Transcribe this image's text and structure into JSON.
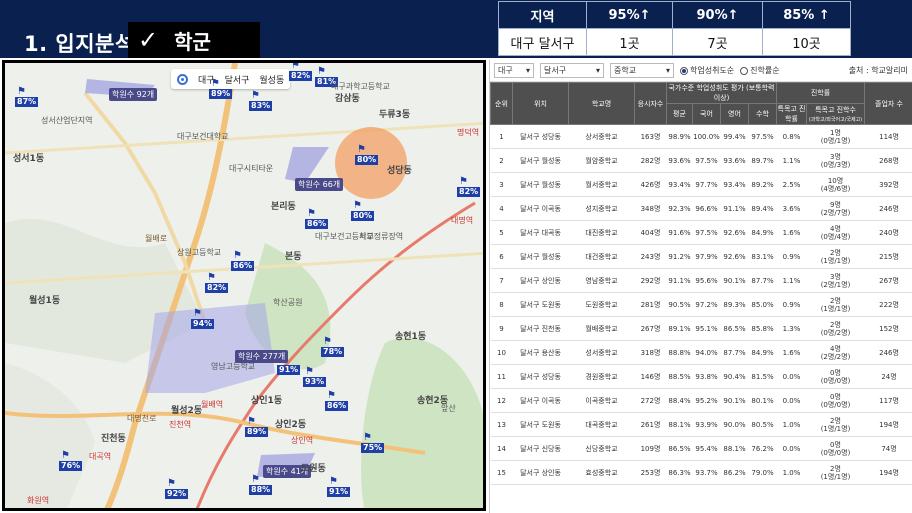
{
  "slide": {
    "title": "1. 입지분석",
    "checkmark": "✓",
    "subject": "학군"
  },
  "summary_table": {
    "headers": [
      "지역",
      "95%↑",
      "90%↑",
      "85% ↑"
    ],
    "row": [
      "대구 달서구",
      "1곳",
      "7곳",
      "10곳"
    ]
  },
  "map": {
    "toolbar": {
      "city": "대구",
      "district": "달서구",
      "dong": "월성동"
    },
    "percent_flags": [
      "87%",
      "89%",
      "82%",
      "81%",
      "83%",
      "82%",
      "80%",
      "86%",
      "80%",
      "86%",
      "82%",
      "94%",
      "91%",
      "93%",
      "78%",
      "86%",
      "89%",
      "75%",
      "76%",
      "92%",
      "88%",
      "91%"
    ],
    "student_labels": [
      "학원수 92개",
      "학원수 66개",
      "학원수 277개",
      "학원수 41개"
    ],
    "dong_labels": [
      "감삼동",
      "두류3동",
      "성당동",
      "본리동",
      "본동",
      "월성1동",
      "송현1동",
      "송현2동",
      "상인1동",
      "상인2동",
      "진천동",
      "도원동",
      "월성2동",
      "월배역",
      "상인역",
      "진천역",
      "대곡역",
      "화원역",
      "성서1동"
    ],
    "place_labels": [
      "성서산업단지역",
      "대구보건대학교",
      "서부정류장역",
      "대구시티타운",
      "학산공원",
      "앞산",
      "대구보건고등학교",
      "상원고등학교",
      "대구과학고등학교",
      "영남고등학교",
      "대명역",
      "명덕역"
    ],
    "road_labels": [
      "대명천로",
      "월배로"
    ]
  },
  "panel": {
    "filters": {
      "city": "대구",
      "district": "달서구",
      "level": "중학교"
    },
    "radio_options": [
      "학업성취도순",
      "진학률순"
    ],
    "source": "출처 : 학교알리미",
    "headers": {
      "rank": "순위",
      "location": "위치",
      "school": "학교명",
      "applicants": "응시자수",
      "achievement_group": "국가수준 학업성취도 평가 (보통학력이상)",
      "avg": "평균",
      "korean": "국어",
      "english": "영어",
      "math": "수학",
      "progress_group": "진학률",
      "special_rate": "특목고 진학률",
      "special_count": "특목고 진학수",
      "special_count_sub": "(과학고/외국어고/국제고)",
      "grads": "졸업자 수"
    },
    "rows": [
      [
        "1",
        "달서구 성당동",
        "상서중학교",
        "163명",
        "98.9%",
        "100.0%",
        "99.4%",
        "97.5%",
        "0.8%",
        "1명",
        "(0명/1명)",
        "114명"
      ],
      [
        "2",
        "달서구 월성동",
        "월암중학교",
        "282명",
        "93.6%",
        "97.5%",
        "93.6%",
        "89.7%",
        "1.1%",
        "3명",
        "(0명/3명)",
        "268명"
      ],
      [
        "3",
        "달서구 월성동",
        "월서중학교",
        "426명",
        "93.4%",
        "97.7%",
        "93.4%",
        "89.2%",
        "2.5%",
        "10명",
        "(4명/6명)",
        "392명"
      ],
      [
        "4",
        "달서구 이곡동",
        "성지중학교",
        "348명",
        "92.3%",
        "96.6%",
        "91.1%",
        "89.4%",
        "3.6%",
        "9명",
        "(2명/7명)",
        "246명"
      ],
      [
        "5",
        "달서구 대곡동",
        "대진중학교",
        "404명",
        "91.6%",
        "97.5%",
        "92.6%",
        "84.9%",
        "1.6%",
        "4명",
        "(0명/4명)",
        "240명"
      ],
      [
        "6",
        "달서구 월성동",
        "대건중학교",
        "243명",
        "91.2%",
        "97.9%",
        "92.6%",
        "83.1%",
        "0.9%",
        "2명",
        "(1명/1명)",
        "215명"
      ],
      [
        "7",
        "달서구 상인동",
        "영남중학교",
        "292명",
        "91.1%",
        "95.6%",
        "90.1%",
        "87.7%",
        "1.1%",
        "3명",
        "(2명/1명)",
        "267명"
      ],
      [
        "8",
        "달서구 도원동",
        "도원중학교",
        "281명",
        "90.5%",
        "97.2%",
        "89.3%",
        "85.0%",
        "0.9%",
        "2명",
        "(1명/1명)",
        "222명"
      ],
      [
        "9",
        "달서구 진천동",
        "월배중학교",
        "267명",
        "89.1%",
        "95.1%",
        "86.5%",
        "85.8%",
        "1.3%",
        "2명",
        "(0명/2명)",
        "152명"
      ],
      [
        "10",
        "달서구 용산동",
        "성서중학교",
        "318명",
        "88.8%",
        "94.0%",
        "87.7%",
        "84.9%",
        "1.6%",
        "4명",
        "(2명/2명)",
        "246명"
      ],
      [
        "11",
        "달서구 성당동",
        "경원중학교",
        "146명",
        "88.5%",
        "93.8%",
        "90.4%",
        "81.5%",
        "0.0%",
        "0명",
        "(0명/0명)",
        "24명"
      ],
      [
        "12",
        "달서구 이곡동",
        "이곡중학교",
        "272명",
        "88.4%",
        "95.2%",
        "90.1%",
        "80.1%",
        "0.0%",
        "0명",
        "(0명/0명)",
        "117명"
      ],
      [
        "13",
        "달서구 도원동",
        "대곡중학교",
        "261명",
        "88.1%",
        "93.9%",
        "90.0%",
        "80.5%",
        "1.0%",
        "2명",
        "(1명/1명)",
        "194명"
      ],
      [
        "14",
        "달서구 신당동",
        "신당중학교",
        "109명",
        "86.5%",
        "95.4%",
        "88.1%",
        "76.2%",
        "0.0%",
        "0명",
        "(0명/0명)",
        "74명"
      ],
      [
        "15",
        "달서구 상인동",
        "효성중학교",
        "253명",
        "86.3%",
        "93.7%",
        "86.2%",
        "79.0%",
        "1.0%",
        "2명",
        "(1명/1명)",
        "194명"
      ]
    ]
  }
}
